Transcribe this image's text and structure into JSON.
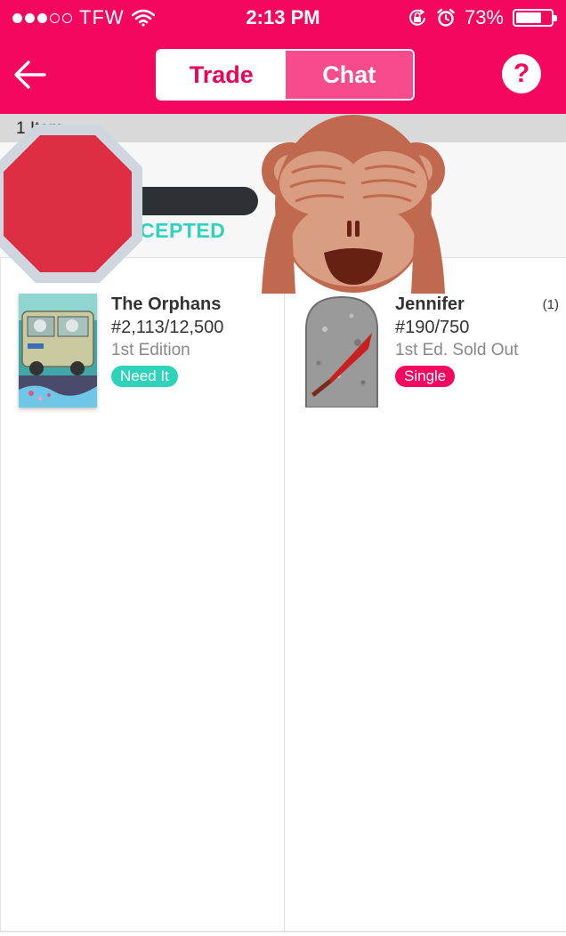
{
  "status_bar": {
    "carrier": "TFW",
    "time": "2:13 PM",
    "battery": "73%",
    "battery_level": 0.73,
    "signal_bars_filled": 3,
    "signal_bars_total": 5
  },
  "nav": {
    "tabs": [
      {
        "label": "Trade",
        "active": true
      },
      {
        "label": "Chat",
        "active": false
      }
    ],
    "help_label": "?"
  },
  "items_bar": {
    "count_label": "1 Item"
  },
  "trade_status": {
    "label": "CEPTED",
    "overlays": [
      "stop-sign-emoji",
      "see-no-evil-monkey-emoji"
    ]
  },
  "left_card": {
    "title": "The Orphans",
    "number": "#2,113/12,500",
    "edition": "1st Edition",
    "badge": "Need It"
  },
  "right_card": {
    "title": "Jennifer",
    "quantity": "(1)",
    "number": "#190/750",
    "edition": "1st Ed. Sold Out",
    "badge": "Single"
  },
  "colors": {
    "brand_pink": "#f5075f",
    "teal": "#2fd3b9",
    "divider_gray": "#d9d9d9"
  }
}
